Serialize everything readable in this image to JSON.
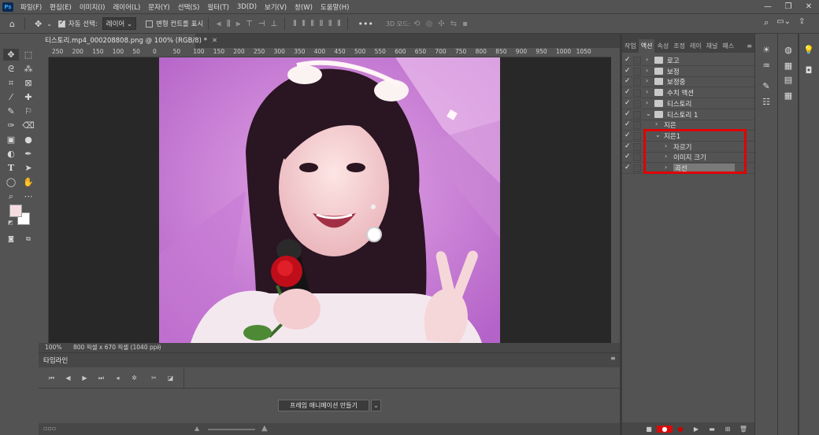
{
  "menubar": {
    "logo": "Ps",
    "items": [
      "파일(F)",
      "편집(E)",
      "이미지(I)",
      "레이어(L)",
      "문자(Y)",
      "선택(S)",
      "필터(T)",
      "3D(D)",
      "보기(V)",
      "창(W)",
      "도움말(H)"
    ]
  },
  "options": {
    "auto_select_label": "자동 선택:",
    "auto_select_value": "레이어",
    "transform_label": "변형 컨트롤 표시",
    "mode_3d_label": "3D 모드:",
    "more": "•••"
  },
  "document": {
    "tab_title": "티스토리.mp4_000208808.png @ 100% (RGB/8) *",
    "ruler_ticks": [
      "250",
      "200",
      "150",
      "100",
      "50",
      "0",
      "50",
      "100",
      "150",
      "200",
      "250",
      "300",
      "350",
      "400",
      "450",
      "500",
      "550",
      "600",
      "650",
      "700",
      "750",
      "800",
      "850",
      "900",
      "950",
      "1000",
      "1050"
    ],
    "zoom": "100%",
    "size_info": "800 픽셀 x 670 픽셀 (1040 ppi)"
  },
  "timeline": {
    "title": "타임라인",
    "create_label": "프레임 애니메이션 만들기"
  },
  "panels": {
    "tabs": [
      "작업",
      "액션",
      "속성",
      "조정",
      "레이",
      "채널",
      "패스"
    ],
    "active_tab": "액션",
    "actions": [
      {
        "label": "로고",
        "type": "set",
        "level": 0,
        "expanded": false
      },
      {
        "label": "보정",
        "type": "set",
        "level": 0,
        "expanded": false
      },
      {
        "label": "보정중",
        "type": "set",
        "level": 0,
        "expanded": false
      },
      {
        "label": "수치 액션",
        "type": "set",
        "level": 0,
        "expanded": false
      },
      {
        "label": "티스토리",
        "type": "set",
        "level": 0,
        "expanded": false
      },
      {
        "label": "티스토리 1",
        "type": "set",
        "level": 0,
        "expanded": true
      },
      {
        "label": "지은",
        "type": "action",
        "level": 1,
        "expanded": false
      },
      {
        "label": "지은1",
        "type": "action",
        "level": 1,
        "expanded": true
      },
      {
        "label": "자르기",
        "type": "step",
        "level": 2,
        "expanded": false
      },
      {
        "label": "이미지 크기",
        "type": "step",
        "level": 2,
        "expanded": false
      },
      {
        "label": "곡선",
        "type": "step",
        "level": 2,
        "expanded": false,
        "selected": true
      }
    ]
  },
  "colors": {
    "ui_bg": "#535353",
    "dark_bg": "#282828",
    "highlight": "#e00000",
    "record": "#d80a0a",
    "foreground_swatch": "#f4dde0",
    "background_swatch": "#ffffff"
  }
}
